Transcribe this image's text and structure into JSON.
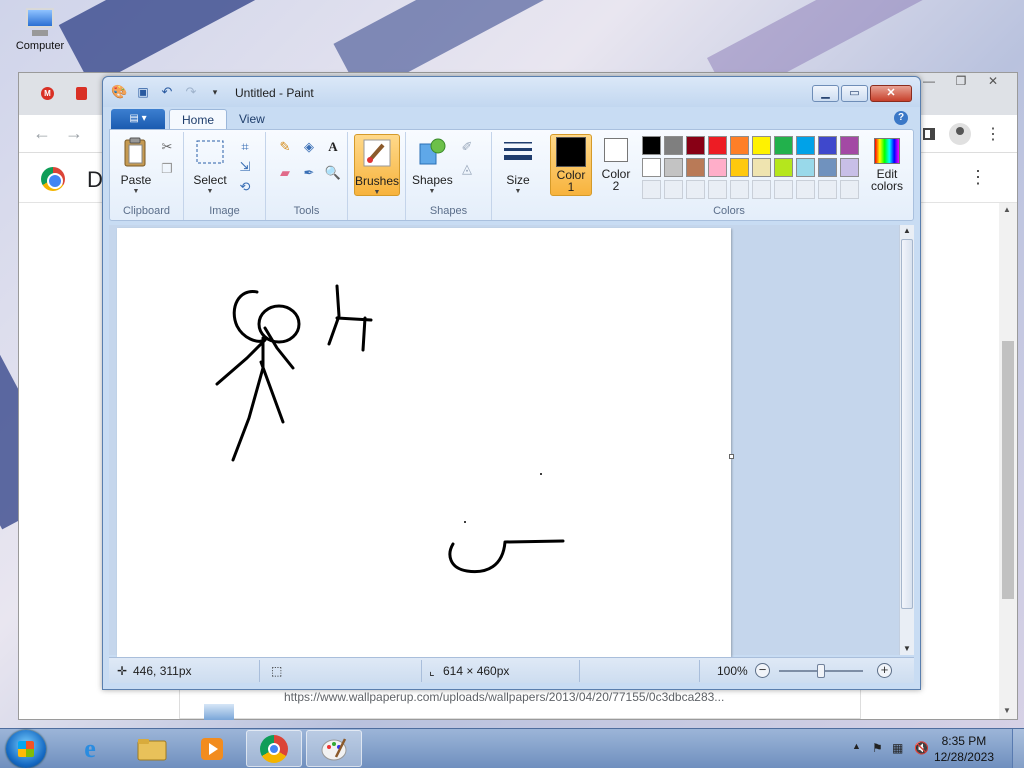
{
  "desktop": {
    "icon_label": "Computer"
  },
  "chrome": {
    "title_initial": "D",
    "status_url": "https://www.wallpaperup.com/uploads/wallpapers/2013/04/20/77155/0c3dbca283...",
    "window_controls": [
      "—",
      "❐",
      "✕"
    ]
  },
  "paint": {
    "title": "Untitled - Paint",
    "tabs": [
      "Home",
      "View"
    ],
    "groups": {
      "clipboard": {
        "label": "Clipboard",
        "paste": "Paste"
      },
      "image": {
        "label": "Image",
        "select": "Select"
      },
      "tools": {
        "label": "Tools"
      },
      "brushes": {
        "label": "Brushes"
      },
      "shapes": {
        "label": "Shapes",
        "button": "Shapes"
      },
      "size": {
        "label": "Size"
      },
      "colors": {
        "label": "Colors",
        "color1": "Color\n1",
        "color2": "Color\n2",
        "color1_line1": "Color",
        "color1_line2": "1",
        "color2_line1": "Color",
        "color2_line2": "2",
        "edit_line1": "Edit",
        "edit_line2": "colors",
        "palette_row1": [
          "#000000",
          "#7f7f7f",
          "#880015",
          "#ed1c24",
          "#ff7f27",
          "#fff200",
          "#22b14c",
          "#00a2e8",
          "#3f48cc",
          "#a349a4"
        ],
        "palette_row2": [
          "#ffffff",
          "#c3c3c3",
          "#b97a57",
          "#ffaec9",
          "#ffc90e",
          "#efe4b0",
          "#b5e61d",
          "#99d9ea",
          "#7092be",
          "#c8bfe7"
        ],
        "primary": "#000000",
        "secondary": "#ffffff"
      }
    },
    "status": {
      "cursor_pos": "446, 311px",
      "image_size": "614 × 460px",
      "zoom": "100%"
    }
  },
  "taskbar": {
    "time": "8:35 PM",
    "date": "12/28/2023"
  }
}
